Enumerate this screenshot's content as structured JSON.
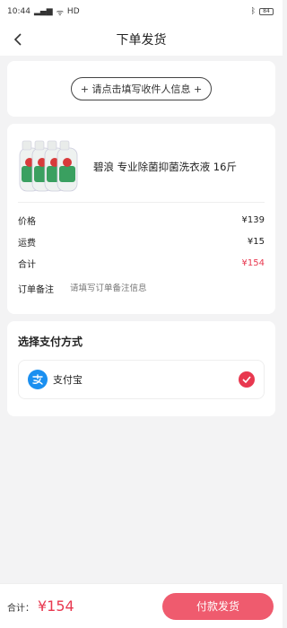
{
  "status_bar": {
    "time": "10:44",
    "network": "HD",
    "battery": "84"
  },
  "header": {
    "title": "下单发货"
  },
  "address": {
    "button_label": "+ 请点击填写收件人信息 +"
  },
  "order": {
    "product_name": "碧浪 专业除菌抑菌洗衣液 16斤",
    "rows": [
      {
        "label": "价格",
        "value": "¥139"
      },
      {
        "label": "运费",
        "value": "¥15"
      },
      {
        "label": "合计",
        "value": "¥154"
      }
    ],
    "remark_label": "订单备注",
    "remark_placeholder": "请填写订单备注信息"
  },
  "payment": {
    "title": "选择支付方式",
    "options": [
      {
        "label": "支付宝",
        "selected": true
      }
    ]
  },
  "footer": {
    "total_label": "合计：",
    "total_value": "¥154",
    "submit_label": "付款发货"
  },
  "colors": {
    "accent": "#e8384f",
    "button": "#ef5b6e",
    "alipay": "#1a8ff0"
  }
}
